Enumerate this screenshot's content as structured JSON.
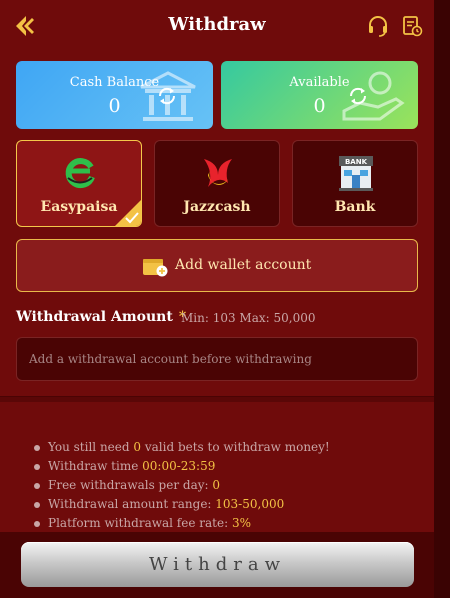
{
  "header": {
    "title": "Withdraw",
    "back_icon": "back-arrow-icon",
    "support_icon": "headset-icon",
    "record_icon": "record-list-icon"
  },
  "balances": [
    {
      "label": "Cash Balance",
      "value": "0",
      "color": "#3fa6f4"
    },
    {
      "label": "Available",
      "value": "0",
      "color": "#35c9a0"
    }
  ],
  "methods": [
    {
      "label": "Easypaisa",
      "selected": true
    },
    {
      "label": "Jazzcash",
      "selected": false
    },
    {
      "label": "Bank",
      "selected": false,
      "logo_text": "BANK"
    }
  ],
  "add_wallet": {
    "label": "Add wallet account"
  },
  "amount": {
    "title": "Withdrawal Amount",
    "required_mark": "*",
    "range": "Min: 103 Max: 50,000",
    "placeholder": "Add a withdrawal account before withdrawing"
  },
  "rules": [
    {
      "pre": "You still need ",
      "hl": "0",
      "post": " valid bets to withdraw money!"
    },
    {
      "pre": "Withdraw time ",
      "hl": "00:00-23:59",
      "post": ""
    },
    {
      "pre": "Free withdrawals per day: ",
      "hl": "0",
      "post": ""
    },
    {
      "pre": "Withdrawal amount range: ",
      "hl": "103-50,000",
      "post": ""
    },
    {
      "pre": "Platform withdrawal fee rate: ",
      "hl": "3%",
      "post": ""
    }
  ],
  "submit": {
    "label": "Withdraw"
  },
  "colors": {
    "background": "#6f0b0b",
    "accent": "#f3c245",
    "panel": "#4a0404"
  }
}
